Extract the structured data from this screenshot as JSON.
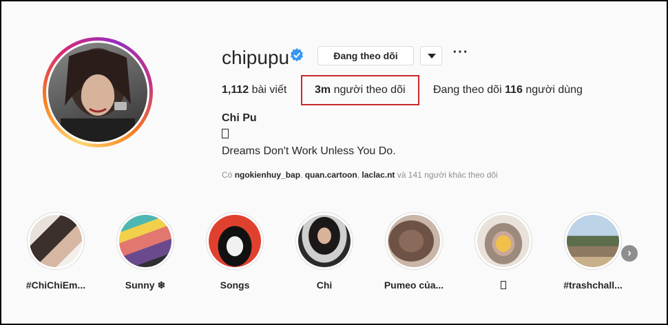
{
  "profile": {
    "username": "chipupu",
    "follow_button_label": "Đang theo dõi",
    "more_label": "···",
    "stats": {
      "posts_count": "1,112",
      "posts_label": "bài viết",
      "followers_count": "3m",
      "followers_label": "người theo dõi",
      "following_prefix": "Đang theo dõi",
      "following_count": "116",
      "following_suffix": "người dùng"
    },
    "full_name": "Chi Pu",
    "bio": "Dreams Don't Work Unless You Do.",
    "followed_by": {
      "prefix": "Có",
      "users": [
        "ngokienhuy_bap",
        "quan.cartoon",
        "laclac.nt"
      ],
      "suffix": "và 141 người khác theo dõi"
    }
  },
  "highlights": [
    {
      "label": "#ChiChiEm..."
    },
    {
      "label": "Sunny ❄"
    },
    {
      "label": "Songs"
    },
    {
      "label": "Chi"
    },
    {
      "label": "Pumeo của..."
    },
    {
      "label": ""
    },
    {
      "label": "#trashchall..."
    }
  ],
  "colors": {
    "verified": "#3897f0",
    "highlight_box": "#c62828",
    "text": "#262626",
    "muted": "#8e8e8e"
  }
}
